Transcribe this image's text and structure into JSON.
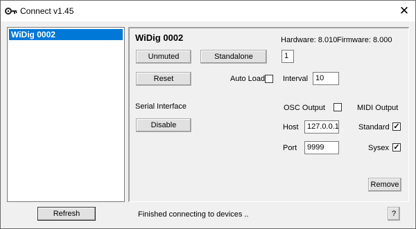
{
  "window": {
    "title": "Connect v1.45",
    "close_glyph": "✕",
    "app_icon": "key-icon"
  },
  "devices": {
    "items": [
      "WiDig 0002"
    ],
    "selected_index": 0
  },
  "detail": {
    "device_name": "WiDig 0002",
    "hardware_label": "Hardware: 8.010",
    "firmware_label": "Firmware: 8.000",
    "mute_button": "Unmuted",
    "mode_button": "Standalone",
    "mode_value": "1",
    "reset_button": "Reset",
    "auto_load_label": "Auto Load",
    "auto_load_checked": false,
    "interval_label": "Interval",
    "interval_value": "10",
    "serial_label": "Serial Interface",
    "serial_button": "Disable",
    "osc_output_label": "OSC Output",
    "osc_output_checked": false,
    "midi_output_label": "MIDI Output",
    "host_label": "Host",
    "host_value": "127.0.0.1",
    "standard_label": "Standard",
    "standard_checked": true,
    "port_label": "Port",
    "port_value": "9999",
    "sysex_label": "Sysex",
    "sysex_checked": true,
    "remove_button": "Remove"
  },
  "footer": {
    "refresh_button": "Refresh",
    "status_text": "Finished connecting to devices ..",
    "help_button": "?"
  },
  "check_glyph": "✓"
}
